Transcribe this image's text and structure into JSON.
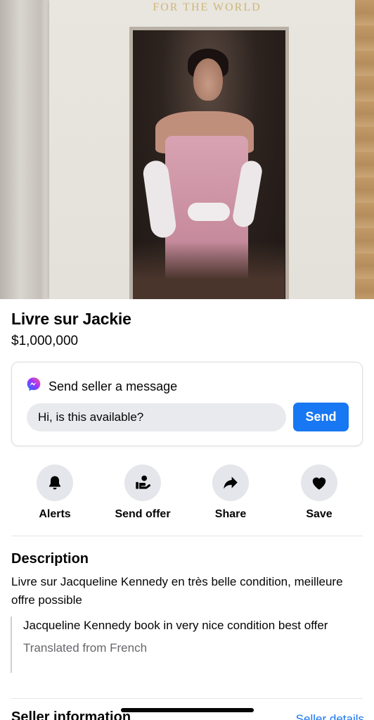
{
  "listing": {
    "cover_text": "FOR THE WORLD",
    "title": "Livre sur Jackie",
    "price": "$1,000,000"
  },
  "message_card": {
    "icon": "messenger-icon",
    "heading": "Send seller a message",
    "input_value": "Hi, is this available?",
    "send_label": "Send"
  },
  "actions": [
    {
      "label": "Alerts",
      "icon": "bell-icon"
    },
    {
      "label": "Send offer",
      "icon": "offer-hand-icon"
    },
    {
      "label": "Share",
      "icon": "share-arrow-icon"
    },
    {
      "label": "Save",
      "icon": "heart-icon"
    }
  ],
  "description": {
    "heading": "Description",
    "text": "Livre sur Jacqueline Kennedy en très belle condition, meilleure offre possible",
    "translation": "Jacqueline Kennedy book in very nice condition best offer",
    "translated_from": "Translated from French"
  },
  "seller": {
    "heading": "Seller information",
    "details_link": "Seller details"
  },
  "colors": {
    "accent": "#1877f2",
    "icon_bg": "#e4e6eb",
    "text": "#050505",
    "secondary_text": "#65676b"
  }
}
